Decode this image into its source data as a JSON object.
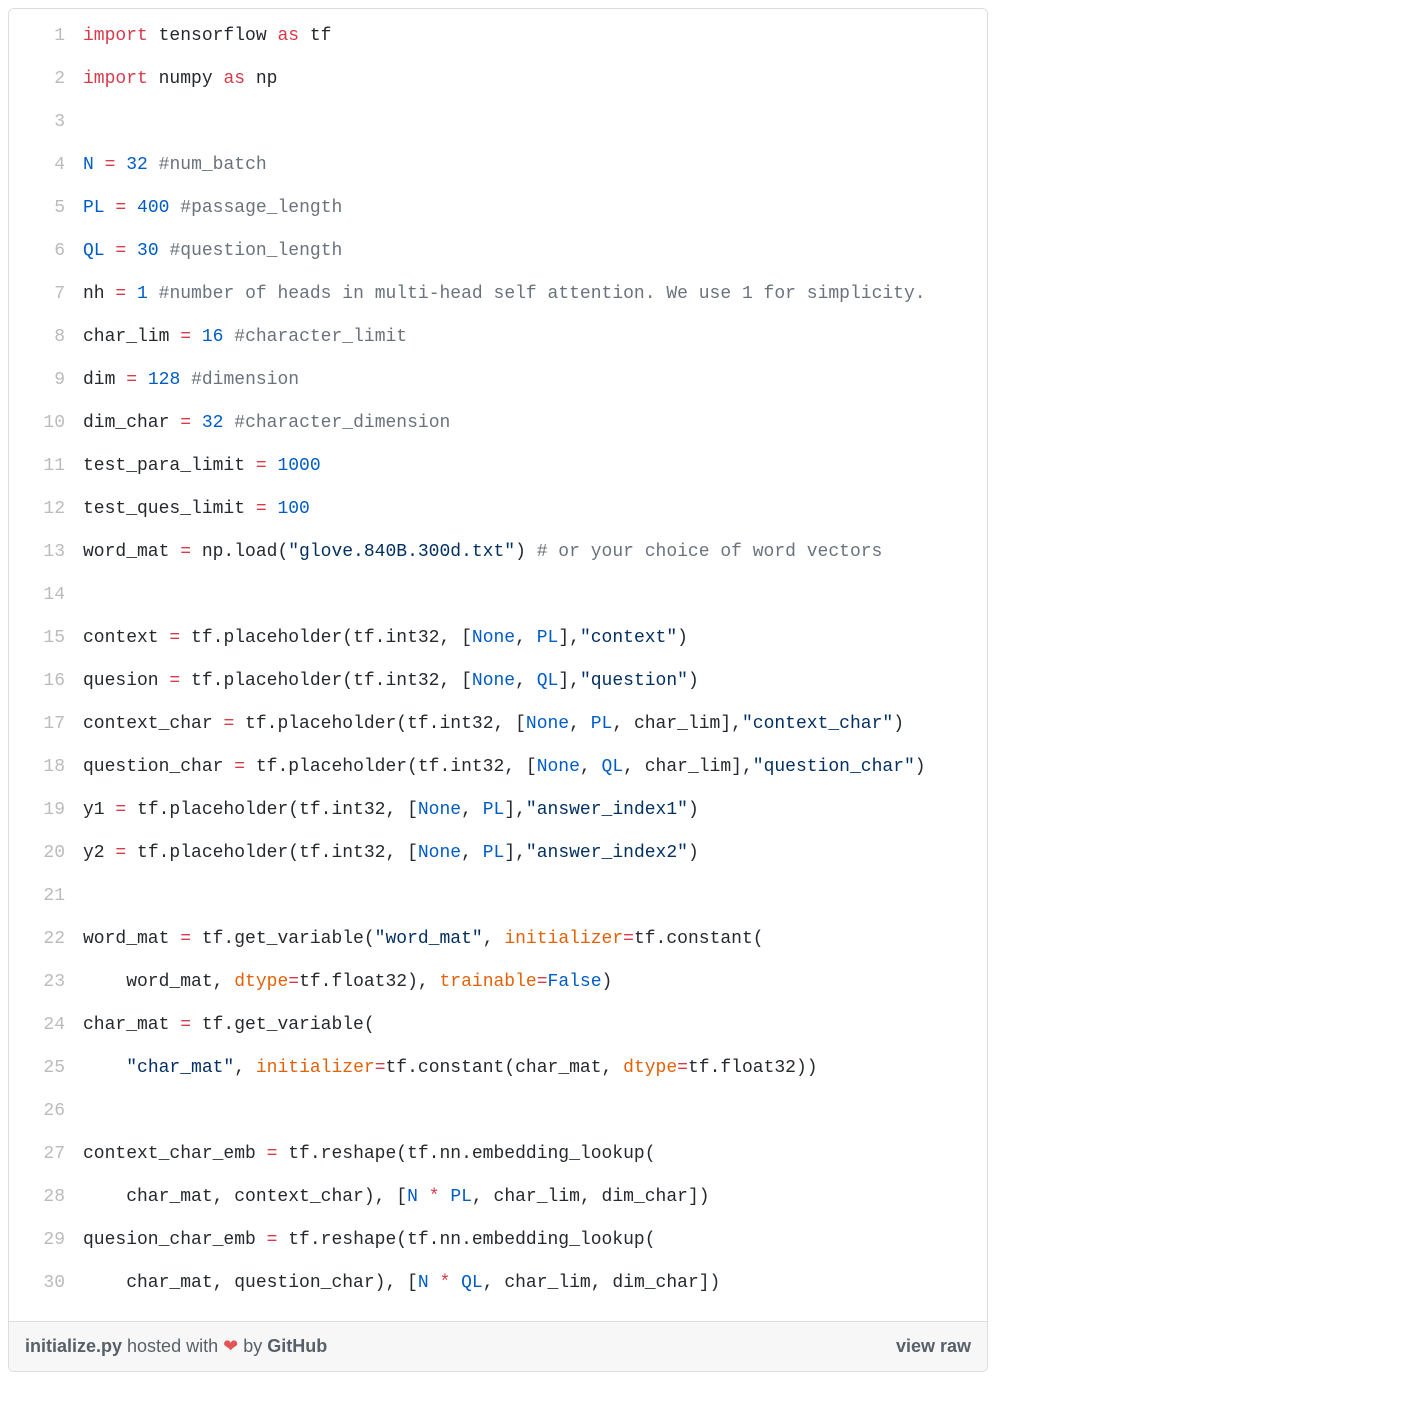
{
  "meta": {
    "filename": "initialize.py",
    "hosted_with": " hosted with ",
    "heart": "❤",
    "by": " by ",
    "host": "GitHub",
    "view_raw": "view raw"
  },
  "lines": [
    {
      "n": 1,
      "tokens": [
        {
          "t": "import",
          "c": "kw"
        },
        {
          "t": " tensorflow ",
          "c": "name"
        },
        {
          "t": "as",
          "c": "kw"
        },
        {
          "t": " tf",
          "c": "name"
        }
      ]
    },
    {
      "n": 2,
      "tokens": [
        {
          "t": "import",
          "c": "kw"
        },
        {
          "t": " numpy ",
          "c": "name"
        },
        {
          "t": "as",
          "c": "kw"
        },
        {
          "t": " np",
          "c": "name"
        }
      ]
    },
    {
      "n": 3,
      "tokens": []
    },
    {
      "n": 4,
      "tokens": [
        {
          "t": "N",
          "c": "const"
        },
        {
          "t": " ",
          "c": "name"
        },
        {
          "t": "=",
          "c": "op"
        },
        {
          "t": " ",
          "c": "name"
        },
        {
          "t": "32",
          "c": "num"
        },
        {
          "t": " ",
          "c": "name"
        },
        {
          "t": "#num_batch",
          "c": "com"
        }
      ]
    },
    {
      "n": 5,
      "tokens": [
        {
          "t": "PL",
          "c": "const"
        },
        {
          "t": " ",
          "c": "name"
        },
        {
          "t": "=",
          "c": "op"
        },
        {
          "t": " ",
          "c": "name"
        },
        {
          "t": "400",
          "c": "num"
        },
        {
          "t": " ",
          "c": "name"
        },
        {
          "t": "#passage_length",
          "c": "com"
        }
      ]
    },
    {
      "n": 6,
      "tokens": [
        {
          "t": "QL",
          "c": "const"
        },
        {
          "t": " ",
          "c": "name"
        },
        {
          "t": "=",
          "c": "op"
        },
        {
          "t": " ",
          "c": "name"
        },
        {
          "t": "30",
          "c": "num"
        },
        {
          "t": " ",
          "c": "name"
        },
        {
          "t": "#question_length",
          "c": "com"
        }
      ]
    },
    {
      "n": 7,
      "tokens": [
        {
          "t": "nh ",
          "c": "name"
        },
        {
          "t": "=",
          "c": "op"
        },
        {
          "t": " ",
          "c": "name"
        },
        {
          "t": "1",
          "c": "num"
        },
        {
          "t": " ",
          "c": "name"
        },
        {
          "t": "#number of heads in multi-head self attention. We use 1 for simplicity.",
          "c": "com"
        }
      ]
    },
    {
      "n": 8,
      "tokens": [
        {
          "t": "char_lim ",
          "c": "name"
        },
        {
          "t": "=",
          "c": "op"
        },
        {
          "t": " ",
          "c": "name"
        },
        {
          "t": "16",
          "c": "num"
        },
        {
          "t": " ",
          "c": "name"
        },
        {
          "t": "#character_limit",
          "c": "com"
        }
      ]
    },
    {
      "n": 9,
      "tokens": [
        {
          "t": "dim ",
          "c": "name"
        },
        {
          "t": "=",
          "c": "op"
        },
        {
          "t": " ",
          "c": "name"
        },
        {
          "t": "128",
          "c": "num"
        },
        {
          "t": " ",
          "c": "name"
        },
        {
          "t": "#dimension",
          "c": "com"
        }
      ]
    },
    {
      "n": 10,
      "tokens": [
        {
          "t": "dim_char ",
          "c": "name"
        },
        {
          "t": "=",
          "c": "op"
        },
        {
          "t": " ",
          "c": "name"
        },
        {
          "t": "32",
          "c": "num"
        },
        {
          "t": " ",
          "c": "name"
        },
        {
          "t": "#character_dimension",
          "c": "com"
        }
      ]
    },
    {
      "n": 11,
      "tokens": [
        {
          "t": "test_para_limit ",
          "c": "name"
        },
        {
          "t": "=",
          "c": "op"
        },
        {
          "t": " ",
          "c": "name"
        },
        {
          "t": "1000",
          "c": "num"
        }
      ]
    },
    {
      "n": 12,
      "tokens": [
        {
          "t": "test_ques_limit ",
          "c": "name"
        },
        {
          "t": "=",
          "c": "op"
        },
        {
          "t": " ",
          "c": "name"
        },
        {
          "t": "100",
          "c": "num"
        }
      ]
    },
    {
      "n": 13,
      "tokens": [
        {
          "t": "word_mat ",
          "c": "name"
        },
        {
          "t": "=",
          "c": "op"
        },
        {
          "t": " np.load(",
          "c": "name"
        },
        {
          "t": "\"glove.840B.300d.txt\"",
          "c": "str"
        },
        {
          "t": ") ",
          "c": "name"
        },
        {
          "t": "# or your choice of word vectors",
          "c": "com"
        }
      ]
    },
    {
      "n": 14,
      "tokens": []
    },
    {
      "n": 15,
      "tokens": [
        {
          "t": "context ",
          "c": "name"
        },
        {
          "t": "=",
          "c": "op"
        },
        {
          "t": " tf.placeholder(tf.int32, [",
          "c": "name"
        },
        {
          "t": "None",
          "c": "const"
        },
        {
          "t": ", ",
          "c": "name"
        },
        {
          "t": "PL",
          "c": "const"
        },
        {
          "t": "],",
          "c": "name"
        },
        {
          "t": "\"context\"",
          "c": "str"
        },
        {
          "t": ")",
          "c": "name"
        }
      ]
    },
    {
      "n": 16,
      "tokens": [
        {
          "t": "quesion ",
          "c": "name"
        },
        {
          "t": "=",
          "c": "op"
        },
        {
          "t": " tf.placeholder(tf.int32, [",
          "c": "name"
        },
        {
          "t": "None",
          "c": "const"
        },
        {
          "t": ", ",
          "c": "name"
        },
        {
          "t": "QL",
          "c": "const"
        },
        {
          "t": "],",
          "c": "name"
        },
        {
          "t": "\"question\"",
          "c": "str"
        },
        {
          "t": ")",
          "c": "name"
        }
      ]
    },
    {
      "n": 17,
      "tokens": [
        {
          "t": "context_char ",
          "c": "name"
        },
        {
          "t": "=",
          "c": "op"
        },
        {
          "t": " tf.placeholder(tf.int32, [",
          "c": "name"
        },
        {
          "t": "None",
          "c": "const"
        },
        {
          "t": ", ",
          "c": "name"
        },
        {
          "t": "PL",
          "c": "const"
        },
        {
          "t": ", char_lim],",
          "c": "name"
        },
        {
          "t": "\"context_char\"",
          "c": "str"
        },
        {
          "t": ")",
          "c": "name"
        }
      ]
    },
    {
      "n": 18,
      "tokens": [
        {
          "t": "question_char ",
          "c": "name"
        },
        {
          "t": "=",
          "c": "op"
        },
        {
          "t": " tf.placeholder(tf.int32, [",
          "c": "name"
        },
        {
          "t": "None",
          "c": "const"
        },
        {
          "t": ", ",
          "c": "name"
        },
        {
          "t": "QL",
          "c": "const"
        },
        {
          "t": ", char_lim],",
          "c": "name"
        },
        {
          "t": "\"question_char\"",
          "c": "str"
        },
        {
          "t": ")",
          "c": "name"
        }
      ]
    },
    {
      "n": 19,
      "tokens": [
        {
          "t": "y1 ",
          "c": "name"
        },
        {
          "t": "=",
          "c": "op"
        },
        {
          "t": " tf.placeholder(tf.int32, [",
          "c": "name"
        },
        {
          "t": "None",
          "c": "const"
        },
        {
          "t": ", ",
          "c": "name"
        },
        {
          "t": "PL",
          "c": "const"
        },
        {
          "t": "],",
          "c": "name"
        },
        {
          "t": "\"answer_index1\"",
          "c": "str"
        },
        {
          "t": ")",
          "c": "name"
        }
      ]
    },
    {
      "n": 20,
      "tokens": [
        {
          "t": "y2 ",
          "c": "name"
        },
        {
          "t": "=",
          "c": "op"
        },
        {
          "t": " tf.placeholder(tf.int32, [",
          "c": "name"
        },
        {
          "t": "None",
          "c": "const"
        },
        {
          "t": ", ",
          "c": "name"
        },
        {
          "t": "PL",
          "c": "const"
        },
        {
          "t": "],",
          "c": "name"
        },
        {
          "t": "\"answer_index2\"",
          "c": "str"
        },
        {
          "t": ")",
          "c": "name"
        }
      ]
    },
    {
      "n": 21,
      "tokens": []
    },
    {
      "n": 22,
      "tokens": [
        {
          "t": "word_mat ",
          "c": "name"
        },
        {
          "t": "=",
          "c": "op"
        },
        {
          "t": " tf.get_variable(",
          "c": "name"
        },
        {
          "t": "\"word_mat\"",
          "c": "str"
        },
        {
          "t": ", ",
          "c": "name"
        },
        {
          "t": "initializer",
          "c": "arg"
        },
        {
          "t": "=",
          "c": "op"
        },
        {
          "t": "tf.constant(",
          "c": "name"
        }
      ]
    },
    {
      "n": 23,
      "tokens": [
        {
          "t": "    word_mat, ",
          "c": "name"
        },
        {
          "t": "dtype",
          "c": "arg"
        },
        {
          "t": "=",
          "c": "op"
        },
        {
          "t": "tf.float32), ",
          "c": "name"
        },
        {
          "t": "trainable",
          "c": "arg"
        },
        {
          "t": "=",
          "c": "op"
        },
        {
          "t": "False",
          "c": "const"
        },
        {
          "t": ")",
          "c": "name"
        }
      ]
    },
    {
      "n": 24,
      "tokens": [
        {
          "t": "char_mat ",
          "c": "name"
        },
        {
          "t": "=",
          "c": "op"
        },
        {
          "t": " tf.get_variable(",
          "c": "name"
        }
      ]
    },
    {
      "n": 25,
      "tokens": [
        {
          "t": "    ",
          "c": "name"
        },
        {
          "t": "\"char_mat\"",
          "c": "str"
        },
        {
          "t": ", ",
          "c": "name"
        },
        {
          "t": "initializer",
          "c": "arg"
        },
        {
          "t": "=",
          "c": "op"
        },
        {
          "t": "tf.constant(char_mat, ",
          "c": "name"
        },
        {
          "t": "dtype",
          "c": "arg"
        },
        {
          "t": "=",
          "c": "op"
        },
        {
          "t": "tf.float32))",
          "c": "name"
        }
      ]
    },
    {
      "n": 26,
      "tokens": []
    },
    {
      "n": 27,
      "tokens": [
        {
          "t": "context_char_emb ",
          "c": "name"
        },
        {
          "t": "=",
          "c": "op"
        },
        {
          "t": " tf.reshape(tf.nn.embedding_lookup(",
          "c": "name"
        }
      ]
    },
    {
      "n": 28,
      "tokens": [
        {
          "t": "    char_mat, context_char), [",
          "c": "name"
        },
        {
          "t": "N",
          "c": "const"
        },
        {
          "t": " ",
          "c": "name"
        },
        {
          "t": "*",
          "c": "op"
        },
        {
          "t": " ",
          "c": "name"
        },
        {
          "t": "PL",
          "c": "const"
        },
        {
          "t": ", char_lim, dim_char])",
          "c": "name"
        }
      ]
    },
    {
      "n": 29,
      "tokens": [
        {
          "t": "quesion_char_emb ",
          "c": "name"
        },
        {
          "t": "=",
          "c": "op"
        },
        {
          "t": " tf.reshape(tf.nn.embedding_lookup(",
          "c": "name"
        }
      ]
    },
    {
      "n": 30,
      "tokens": [
        {
          "t": "    char_mat, question_char), [",
          "c": "name"
        },
        {
          "t": "N",
          "c": "const"
        },
        {
          "t": " ",
          "c": "name"
        },
        {
          "t": "*",
          "c": "op"
        },
        {
          "t": " ",
          "c": "name"
        },
        {
          "t": "QL",
          "c": "const"
        },
        {
          "t": ", char_lim, dim_char])",
          "c": "name"
        }
      ]
    }
  ]
}
